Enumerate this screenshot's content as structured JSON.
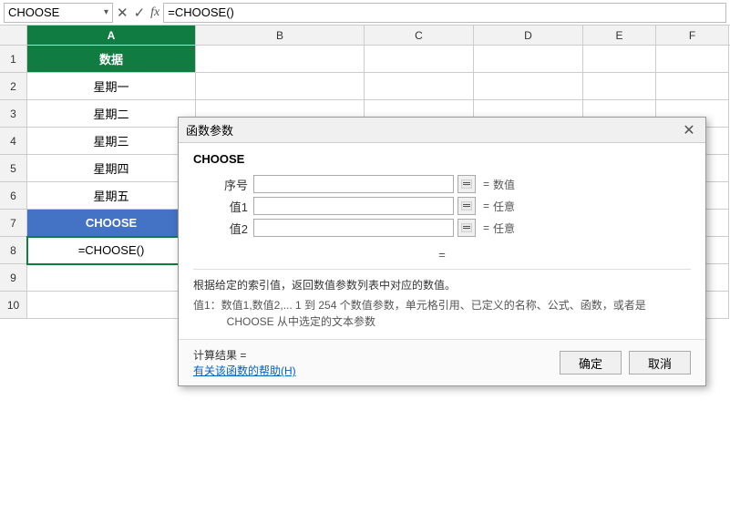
{
  "formulaBar": {
    "nameBox": "CHOOSE",
    "nameBoxArrow": "▾",
    "cancelIcon": "✕",
    "confirmIcon": "✓",
    "fxLabel": "fx",
    "formula": "=CHOOSE()"
  },
  "columns": [
    {
      "id": "A",
      "label": "A",
      "active": true
    },
    {
      "id": "B",
      "label": "B",
      "active": false
    },
    {
      "id": "C",
      "label": "C",
      "active": false
    },
    {
      "id": "D",
      "label": "D",
      "active": false
    },
    {
      "id": "E",
      "label": "E",
      "active": false
    },
    {
      "id": "F",
      "label": "F",
      "active": false
    }
  ],
  "rows": [
    {
      "num": 1,
      "cells": [
        {
          "value": "数据",
          "type": "header"
        },
        {
          "value": ""
        },
        {
          "value": ""
        },
        {
          "value": ""
        },
        {
          "value": ""
        },
        {
          "value": ""
        }
      ]
    },
    {
      "num": 2,
      "cells": [
        {
          "value": "星期一",
          "type": "normal"
        },
        {
          "value": ""
        },
        {
          "value": ""
        },
        {
          "value": ""
        },
        {
          "value": ""
        },
        {
          "value": ""
        }
      ]
    },
    {
      "num": 3,
      "cells": [
        {
          "value": "星期二",
          "type": "normal"
        },
        {
          "value": ""
        },
        {
          "value": ""
        },
        {
          "value": ""
        },
        {
          "value": ""
        },
        {
          "value": ""
        }
      ]
    },
    {
      "num": 4,
      "cells": [
        {
          "value": "星期三",
          "type": "normal"
        },
        {
          "value": ""
        },
        {
          "value": ""
        },
        {
          "value": ""
        },
        {
          "value": ""
        },
        {
          "value": ""
        }
      ]
    },
    {
      "num": 5,
      "cells": [
        {
          "value": "星期四",
          "type": "normal"
        },
        {
          "value": ""
        },
        {
          "value": ""
        },
        {
          "value": ""
        },
        {
          "value": ""
        },
        {
          "value": ""
        }
      ]
    },
    {
      "num": 6,
      "cells": [
        {
          "value": "星期五",
          "type": "normal"
        },
        {
          "value": ""
        },
        {
          "value": ""
        },
        {
          "value": ""
        },
        {
          "value": ""
        },
        {
          "value": ""
        }
      ]
    },
    {
      "num": 7,
      "cells": [
        {
          "value": "CHOOSE",
          "type": "choose"
        },
        {
          "value": ""
        },
        {
          "value": ""
        },
        {
          "value": ""
        },
        {
          "value": ""
        },
        {
          "value": ""
        }
      ]
    },
    {
      "num": 8,
      "cells": [
        {
          "value": "=CHOOSE()",
          "type": "active"
        },
        {
          "value": ""
        },
        {
          "value": ""
        },
        {
          "value": ""
        },
        {
          "value": ""
        },
        {
          "value": ""
        }
      ]
    },
    {
      "num": 9,
      "cells": [
        {
          "value": ""
        },
        {
          "value": ""
        },
        {
          "value": ""
        },
        {
          "value": ""
        },
        {
          "value": ""
        },
        {
          "value": ""
        }
      ]
    },
    {
      "num": 10,
      "cells": [
        {
          "value": ""
        },
        {
          "value": ""
        },
        {
          "value": ""
        },
        {
          "value": ""
        },
        {
          "value": ""
        },
        {
          "value": ""
        }
      ]
    }
  ],
  "dialog": {
    "title": "函数参数",
    "closeIcon": "✕",
    "funcName": "CHOOSE",
    "params": [
      {
        "label": "序号",
        "value": "",
        "result": "数值"
      },
      {
        "label": "值1",
        "value": "",
        "result": "任意"
      },
      {
        "label": "值2",
        "value": "",
        "result": "任意"
      }
    ],
    "equalsSign": "=",
    "descMain": "根据给定的索引值，返回数值参数列表中对应的数值。",
    "descDetail": "值1：数值1,数值2,... 1 到 254 个数值参数，单元格引用、已定义的名称、公式、函数，或者是\n            CHOOSE 从中选定的文本参数",
    "calcResult": "计算结果 =",
    "helpLink": "有关该函数的帮助(H)",
    "confirmBtn": "确定",
    "cancelBtn": "取消"
  }
}
